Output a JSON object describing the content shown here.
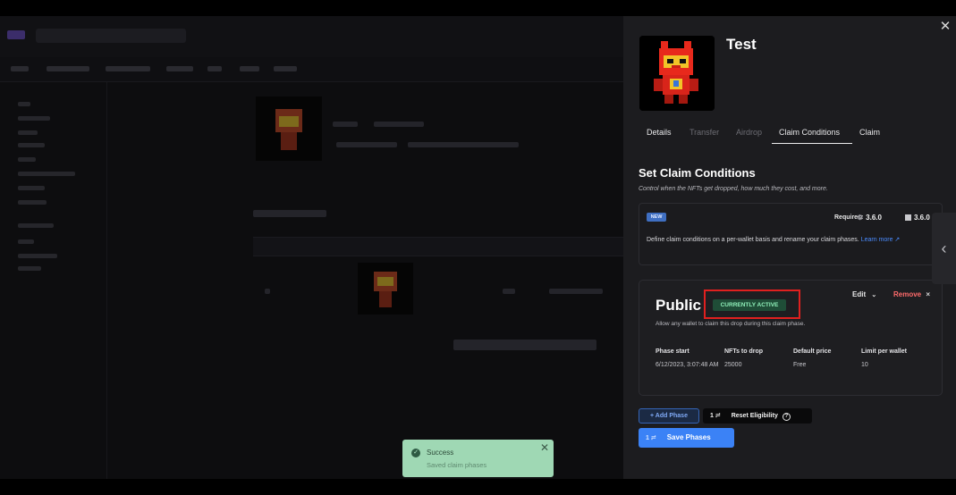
{
  "drawer": {
    "nft_name": "Test",
    "close_icon": "close-icon",
    "tabs": [
      {
        "label": "Details"
      },
      {
        "label": "Transfer"
      },
      {
        "label": "Airdrop"
      },
      {
        "label": "Claim Conditions"
      },
      {
        "label": "Claim"
      }
    ],
    "active_tab": "Claim Conditions",
    "section_title": "Set Claim Conditions",
    "section_subtitle": "Control when the NFTs get dropped, how much they cost, and more.",
    "info": {
      "badge": "NEW",
      "requires_label": "Requires:",
      "requires_v1": "3.6.0",
      "requires_v2": "3.6.0",
      "text": "Define claim conditions on a per-wallet basis and rename your claim phases.",
      "link": "Learn more ↗"
    },
    "phase": {
      "name": "Public",
      "status_badge": "CURRENTLY ACTIVE",
      "edit_label": "Edit",
      "remove_label": "Remove",
      "description": "Allow any wallet to claim this drop during this claim phase.",
      "stats": [
        {
          "label": "Phase start",
          "value": "6/12/2023, 3:07:48 AM"
        },
        {
          "label": "NFTs to drop",
          "value": "25000"
        },
        {
          "label": "Default price",
          "value": "Free"
        },
        {
          "label": "Limit per wallet",
          "value": "10"
        }
      ]
    },
    "actions": {
      "add_phase": "+ Add Phase",
      "reset_kbd": "1 ≓",
      "reset_label": "Reset Eligibility",
      "save_kbd": "1 ≓",
      "save_label": "Save Phases"
    }
  },
  "toast": {
    "title": "Success",
    "message": "Saved claim phases"
  },
  "colors": {
    "accent": "#3b82f6",
    "active_badge_bg": "#1f4d37",
    "highlight": "#e0201f",
    "remove": "#ff6b6b",
    "toast_bg": "#9fd8b4"
  }
}
